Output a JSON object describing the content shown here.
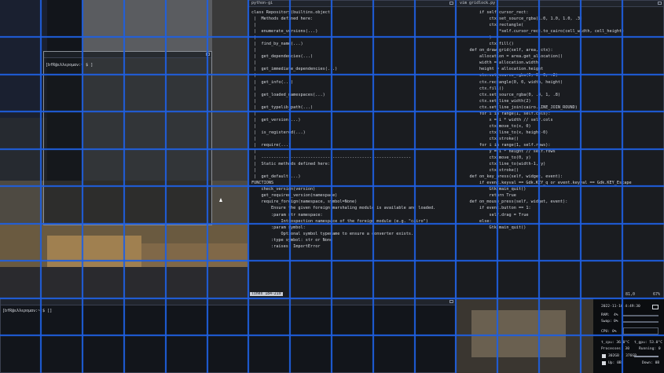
{
  "grid": {
    "cols": 16,
    "rows": 10,
    "color": "#1f5fe0"
  },
  "windows": {
    "python_help": {
      "title": "python-gi",
      "status": "lines 184-219",
      "lines": [
        "class Repository(builtins.object)",
        " |  Methods defined here:",
        " |",
        " |  enumerate_versions(...)",
        " |",
        " |  find_by_name(...)",
        " |",
        " |  get_dependencies(...)",
        " |",
        " |  get_immediate_dependencies(...)",
        " |",
        " |  get_info(...)",
        " |",
        " |  get_loaded_namespaces(...)",
        " |",
        " |  get_typelib_path(...)",
        " |",
        " |  get_version(...)",
        " |",
        " |  is_registered(...)",
        " |",
        " |  require(...)",
        " |",
        " |  -------------------------------------------------------------",
        " |  Static methods defined here:",
        " |",
        " |  get_default(...)",
        "",
        "FUNCTIONS",
        "    check_version(version)",
        "",
        "    get_required_version(namespace)",
        "",
        "    require_foreign(namespace, symbol=None)",
        "        Ensure the given foreign marshaling module is available and loaded.",
        "",
        "        :param str namespace:",
        "            Introspection namespace of the foreign module (e.g. \"cairo\")",
        "        :param symbol:",
        "            Optional symbol typename to ensure a converter exists.",
        "        :type symbol: str or None",
        "        :raises: ImportError"
      ]
    },
    "vim_gridlock": {
      "title": "vim gridlock.py",
      "status_pos": "81,0",
      "status_pct": "67%",
      "lines": [
        "        if self.cursor_rect:",
        "            ctx.set_source_rgba(1.0, 1.0, 1.0, .3)",
        "            ctx.rectangle(",
        "                *self.cursor_rect.to_cairo(cell_width, cell_height)",
        "            )",
        "            ctx.fill()",
        "",
        "    def on_draw_grid(self, area, ctx):",
        "",
        "        allocation = area.get_allocation()",
        "        width = allocation.width",
        "        height = allocation.height",
        "",
        "        ctx.set_source_rgba(0, 0, 0, .2)",
        "        ctx.rectangle(0, 0, width, height)",
        "        ctx.fill()",
        "",
        "        ctx.set_source_rgba(0, .4, 1, .8)",
        "        ctx.set_line_width(2)",
        "        ctx.set_line_join(cairo.LINE_JOIN_ROUND)",
        "",
        "        for i in range(1, self.cols):",
        "            x = i * width // self.cols",
        "            ctx.move_to(x, 0)",
        "            ctx.line_to(x, height-0)",
        "            ctx.stroke()",
        "",
        "        for i in range(1, self.rows):",
        "            y = i * height // self.rows",
        "            ctx.move_to(0, y)",
        "            ctx.line_to(width-1, y)",
        "            ctx.stroke()",
        "",
        "    def on_key_press(self, widget, event):",
        "        if event.keyval == Gdk.KEY_q or event.keyval == Gdk.KEY_Escape",
        "            Gtk.main_quit()",
        "            return True",
        "",
        "    def on_mouse_press(self, widget, event):",
        "        if event.button == 1:",
        "            self.drag = True",
        "        else:",
        "            Gtk.main_quit()"
      ]
    },
    "term_float": {
      "prompt": "[bfR@ελλερομαν:~ $ ]"
    },
    "term_bottom": {
      "prompt": "[bfR@ελλερομαν:~]$ []"
    }
  },
  "sysmon": {
    "datetime": "2022-11-16 4:49:30",
    "ram_label": "RAM:",
    "ram_val": "4%",
    "swap_label": "Swap:",
    "swap_val": "0%",
    "cpu_label": "CPU:",
    "cpu_val": "0%",
    "temp_cpu": "t_cpu: 36.0°C",
    "temp_gpu": "t_gpu: 53.0°C",
    "processes": "Processes: 30",
    "running": "Running: 0",
    "disk": "302GB / 376GB",
    "up": "Up: 0B",
    "down": "Down: 0B"
  }
}
